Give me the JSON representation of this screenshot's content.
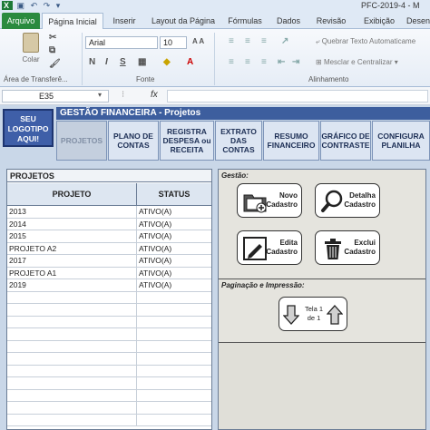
{
  "window": {
    "qat_icons": [
      "excel-logo-icon",
      "save-icon",
      "undo-icon",
      "redo-icon",
      "customize-icon"
    ],
    "title": "PFC-2019-4 - M"
  },
  "ribbon_tabs": [
    {
      "label": "Arquivo"
    },
    {
      "label": "Página Inicial"
    },
    {
      "label": "Inserir"
    },
    {
      "label": "Layout da Página"
    },
    {
      "label": "Fórmulas"
    },
    {
      "label": "Dados"
    },
    {
      "label": "Revisão"
    },
    {
      "label": "Exibição"
    },
    {
      "label": "Desen"
    }
  ],
  "ribbon": {
    "paste_label": "Colar",
    "clipboard_label": "Área de Transferê...",
    "font_name": "Arial",
    "font_size": "10",
    "font_label": "Fonte",
    "bold": "N",
    "italic": "I",
    "underline": "S",
    "wrap_text": "Quebrar Texto Automaticame",
    "merge_center": "Mesclar e Centralizar",
    "alignment_label": "Alinhamento"
  },
  "formula_bar": {
    "cell_ref": "E35",
    "fx": "fx"
  },
  "app": {
    "logo_text": "SEU LOGOTIPO AQUI!",
    "header": "GESTÃO FINANCEIRA  -  Projetos",
    "nav": [
      {
        "label": "PROJETOS"
      },
      {
        "label": "PLANO DE CONTAS"
      },
      {
        "label": "REGISTRA DESPESA ou RECEITA"
      },
      {
        "label": "EXTRATO DAS CONTAS"
      },
      {
        "label": "RESUMO FINANCEIRO"
      },
      {
        "label": "GRÁFICO DE CONTRASTE"
      },
      {
        "label": "CONFIGURA PLANILHA"
      }
    ],
    "projects_title": "PROJETOS",
    "col_project": "PROJETO",
    "col_status": "STATUS",
    "rows": [
      {
        "project": "2013",
        "status": "ATIVO(A)"
      },
      {
        "project": "2014",
        "status": "ATIVO(A)"
      },
      {
        "project": "2015",
        "status": "ATIVO(A)"
      },
      {
        "project": "PROJETO A2",
        "status": "ATIVO(A)"
      },
      {
        "project": "2017",
        "status": "ATIVO(A)"
      },
      {
        "project": "PROJETO A1",
        "status": "ATIVO(A)"
      },
      {
        "project": "2019",
        "status": "ATIVO(A)"
      }
    ],
    "gestao_label": "Gestão:",
    "actions": {
      "new": "Novo Cadastro",
      "detail": "Detalha Cadastro",
      "edit": "Edita Cadastro",
      "delete": "Exclui Cadastro"
    },
    "paging_label": "Paginação e Impressão:",
    "page_indicator": "Tela 1 de 1"
  }
}
